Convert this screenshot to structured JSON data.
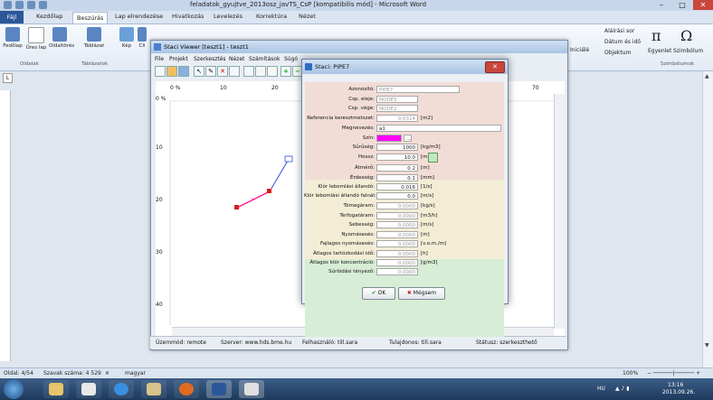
{
  "word": {
    "title": "feladatok_gyujtve_2013osz_javTS_CsP [kompatibilis mód] - Microsoft Word",
    "tabs": [
      "Fájl",
      "Kezdőlap",
      "Beszúrás",
      "Lap elrendezése",
      "Hivatkozás",
      "Levelezés",
      "Korrektúra",
      "Nézet"
    ],
    "active_tab": "Beszúrás",
    "ribbon_buttons": [
      "Fedőlap",
      "Üres lap",
      "Oldaltörés",
      "Táblázat",
      "Kép",
      "Cli"
    ],
    "ribbon_groups": [
      "Oldalak",
      "Táblázatok",
      "Szimbólumok"
    ],
    "ribbon_right": {
      "alairas": "Aláírási sor",
      "datum": "Dátum és idő",
      "objektum": "Objektum",
      "iniciale": "Iniciálé",
      "egyenlet": "Egyenlet",
      "szimbolum": "Szimbólum"
    },
    "status": {
      "page": "Oldal: 4/54",
      "words": "Szavak száma: 4 529",
      "lang": "magyar",
      "zoom": "100%"
    },
    "clock": {
      "time": "13:16",
      "date": "2013.09.26.",
      "lang": "HU"
    }
  },
  "viewer": {
    "title": "Staci Viewer [teszt1] - teszt1",
    "menu": [
      "File",
      "Projekt",
      "Szerkesztés",
      "Nézet",
      "Számítások",
      "Súgó"
    ],
    "hruler": [
      "0 %",
      "10",
      "20",
      "70"
    ],
    "vruler": [
      "0 %",
      "10",
      "20",
      "30",
      "40"
    ],
    "status": {
      "mode": "Üzemmód: remote",
      "server": "Szerver: www.hds.bme.hu",
      "user": "Felhasználó: till.sara",
      "owner": "Tulajdonos: till.sara",
      "state": "Státusz: szerkeszthető"
    }
  },
  "dialog": {
    "title": "Staci: PIPE7",
    "fields": [
      {
        "label": "Azonosító:",
        "value": "PIPE7",
        "unit": "",
        "kind": "gray"
      },
      {
        "label": "Csp. eleje:",
        "value": "NODE5",
        "unit": "",
        "kind": "gray"
      },
      {
        "label": "Csp. vége:",
        "value": "NODE2",
        "unit": "",
        "kind": "gray"
      },
      {
        "label": "Referencia keresztmetszet:",
        "value": "0,0314",
        "unit": "[m2]",
        "kind": "graynum"
      },
      {
        "label": "Megnevezés:",
        "value": "a1",
        "unit": "",
        "kind": "text"
      },
      {
        "label": "Szín:",
        "value": "",
        "unit": "",
        "kind": "color"
      },
      {
        "label": "Sűrűség:",
        "value": "1000",
        "unit": "[kg/m3]",
        "kind": "num"
      },
      {
        "label": "Hossz:",
        "value": "10.0",
        "unit": "[m]",
        "kind": "num"
      },
      {
        "label": "Átmérő:",
        "value": "0.2",
        "unit": "[m]",
        "kind": "num"
      },
      {
        "label": "Érdesség:",
        "value": "0.1",
        "unit": "[mm]",
        "kind": "num"
      },
      {
        "label": "Klór lebomlási állandó:",
        "value": "0.016",
        "unit": "[1/s]",
        "kind": "num"
      },
      {
        "label": "Klór lebomlási állandó falnál:",
        "value": "0.0",
        "unit": "[m/s]",
        "kind": "num"
      },
      {
        "label": "Tömegáram:",
        "value": "0,0000",
        "unit": "[kg/s]",
        "kind": "graynum"
      },
      {
        "label": "Térfogatáram:",
        "value": "0,0000",
        "unit": "[m3/h]",
        "kind": "graynum"
      },
      {
        "label": "Sebesség:",
        "value": "0,0000",
        "unit": "[m/s]",
        "kind": "graynum"
      },
      {
        "label": "Nyomásesés:",
        "value": "0,0000",
        "unit": "[m]",
        "kind": "graynum"
      },
      {
        "label": "Fajlagos nyomásesés:",
        "value": "0,0000",
        "unit": "[v.o.m./m]",
        "kind": "graynum"
      },
      {
        "label": "Átlagos tartózkodási idő:",
        "value": "0,0000",
        "unit": "[h]",
        "kind": "graynum"
      },
      {
        "label": "Átlagos klór koncentráció:",
        "value": "0,0000",
        "unit": "[g/m3]",
        "kind": "graynum"
      },
      {
        "label": "Súrlódási tényező:",
        "value": "0,0000",
        "unit": "",
        "kind": "graynum"
      }
    ],
    "color_swatch": "#ff00ff",
    "ok_label": "OK",
    "cancel_label": "Mégsem"
  },
  "colors": {
    "pipe": "#ff1a8c",
    "node": "#d81f1f",
    "pipe_blue": "#2d4fd6"
  }
}
